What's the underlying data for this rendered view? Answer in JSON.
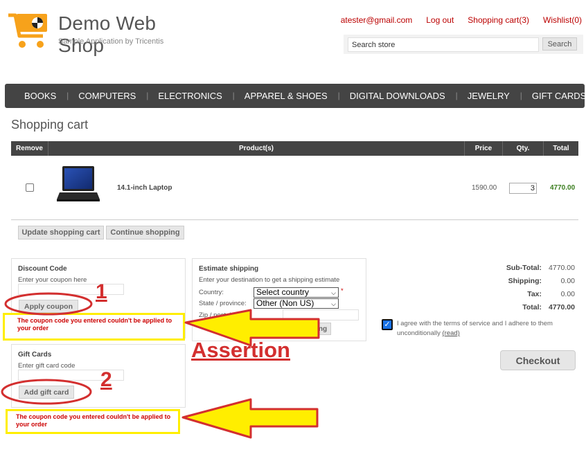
{
  "brand": {
    "title": "Demo Web Shop",
    "subtitle": "Sample Application by Tricentis"
  },
  "header": {
    "links": [
      "atester@gmail.com",
      "Log out",
      "Shopping cart(3)",
      "Wishlist(0)"
    ],
    "search": {
      "value": "Search store",
      "button": "Search"
    }
  },
  "nav": [
    "BOOKS",
    "COMPUTERS",
    "ELECTRONICS",
    "APPAREL & SHOES",
    "DIGITAL DOWNLOADS",
    "JEWELRY",
    "GIFT CARDS"
  ],
  "page_title": "Shopping cart",
  "cart": {
    "headers": {
      "remove": "Remove",
      "product": "Product(s)",
      "price": "Price",
      "qty": "Qty.",
      "total": "Total"
    },
    "items": [
      {
        "name": "14.1-inch Laptop",
        "price": "1590.00",
        "qty": "3",
        "total": "4770.00"
      }
    ],
    "update_label": "Update shopping cart",
    "continue_label": "Continue shopping"
  },
  "discount": {
    "title": "Discount Code",
    "hint": "Enter your coupon here",
    "button": "Apply coupon",
    "error": "The coupon code you entered couldn't be applied to your order"
  },
  "gift": {
    "title": "Gift Cards",
    "hint": "Enter gift card code",
    "button": "Add gift card",
    "error": "The coupon code you entered couldn't be applied to your order"
  },
  "shipping": {
    "title": "Estimate shipping",
    "hint": "Enter your destination to get a shipping estimate",
    "country_label": "Country:",
    "country_value": "Select country",
    "required_mark": "*",
    "state_label": "State / province:",
    "state_value": "Other (Non US)",
    "zip_label": "Zip / postal code:",
    "button": "Estimate shipping"
  },
  "totals": {
    "subtotal_label": "Sub-Total:",
    "subtotal": "4770.00",
    "shipping_label": "Shipping:",
    "shipping": "0.00",
    "tax_label": "Tax:",
    "tax": "0.00",
    "total_label": "Total:",
    "total": "4770.00"
  },
  "terms": {
    "text": "I agree with the terms of service and I adhere to them unconditionally",
    "read": "(read)",
    "checked": true
  },
  "checkout_label": "Checkout",
  "annotations": {
    "one": "1",
    "two": "2",
    "assertion": "Assertion"
  },
  "colors": {
    "accent": "#b00",
    "nav": "#444",
    "total_green": "#3a7d1e",
    "annotation_red": "#d32f2f",
    "highlight_yellow": "#ffee00"
  }
}
